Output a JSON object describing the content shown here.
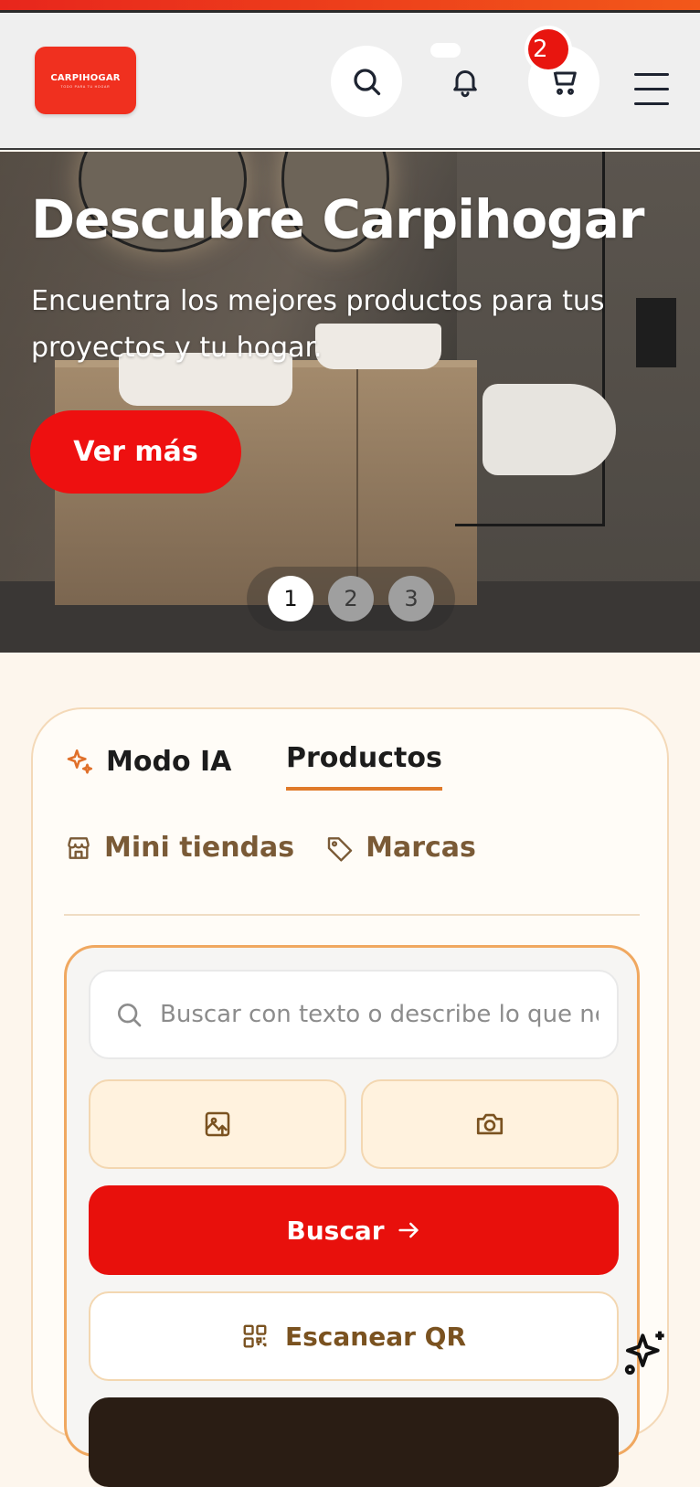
{
  "header": {
    "logo_name": "CARPIHOGAR",
    "logo_tagline": "TODO PARA TU HOGAR",
    "cart_count": "2",
    "brand_color": "#f0301f"
  },
  "hero": {
    "title": "Descubre Carpihogar",
    "subtitle": "Encuentra los mejores productos para tus proyectos y tu hogar.",
    "cta_label": "Ver más",
    "slides": [
      "1",
      "2",
      "3"
    ],
    "active_slide": 1
  },
  "search_card": {
    "tab_ai": "Modo IA",
    "tab_products": "Productos",
    "tab_mini_stores": "Mini tiendas",
    "tab_brands": "Marcas",
    "search_placeholder": "Buscar con texto o describe lo que necesitas",
    "search_value": "",
    "upload_image_icon": "image-upload-icon",
    "camera_icon": "camera-icon",
    "search_button": "Buscar",
    "scan_qr_button": "Escanear QR",
    "accent_color": "#e8100c",
    "highlight_color": "#e07a2a"
  }
}
